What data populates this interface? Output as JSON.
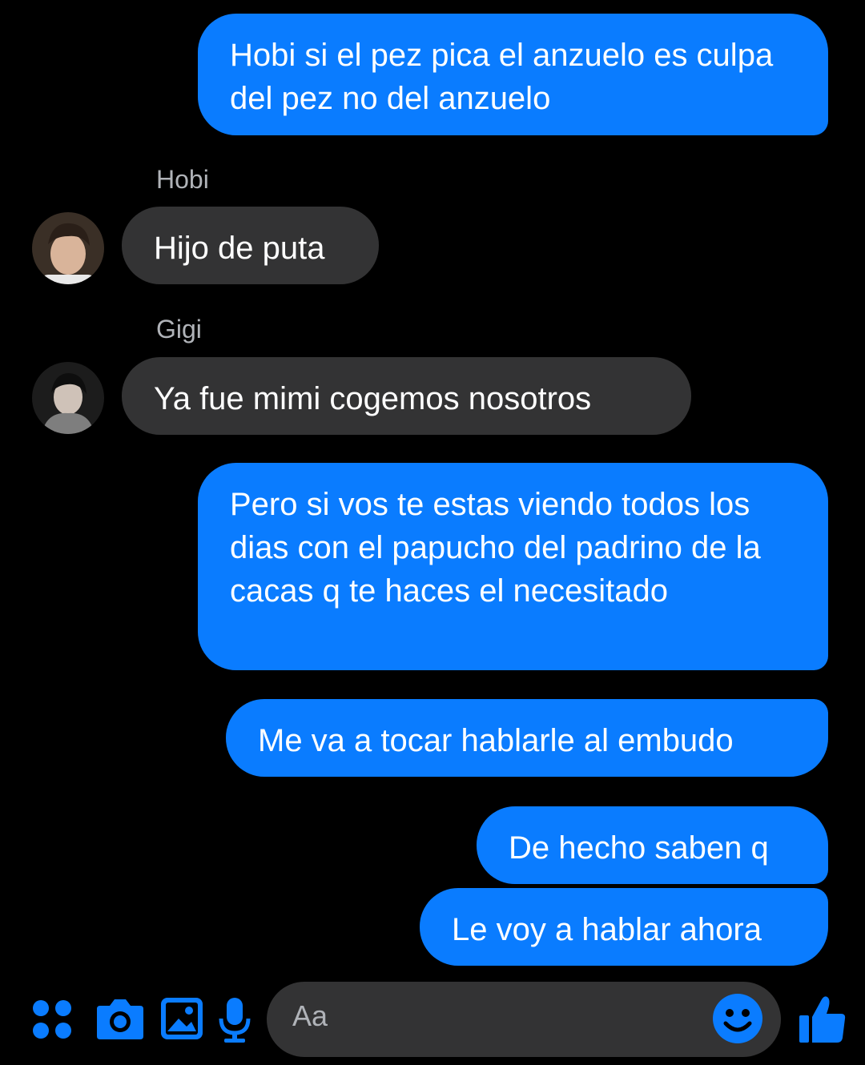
{
  "messages": {
    "m1": "Hobi si el pez pica el anzuelo es culpa del pez no del anzuelo",
    "sender_hobi": "Hobi",
    "m2": "Hijo de puta",
    "sender_gigi": "Gigi",
    "m3": "Ya fue mimi cogemos nosotros",
    "m4": "Pero si vos te estas viendo todos los dias con el papucho del padrino de la cacas q te haces el necesitado",
    "m5": "Me va a tocar hablarle al embudo",
    "m6": "De hecho saben q",
    "m7": "Le voy a hablar ahora"
  },
  "composer": {
    "placeholder": "Aa",
    "icons": [
      "apps-icon",
      "camera-icon",
      "gallery-icon",
      "microphone-icon",
      "emoji-icon",
      "like-icon"
    ]
  },
  "colors": {
    "accent": "#0a7cff",
    "incoming_bubble": "#333334",
    "background": "#000000"
  }
}
